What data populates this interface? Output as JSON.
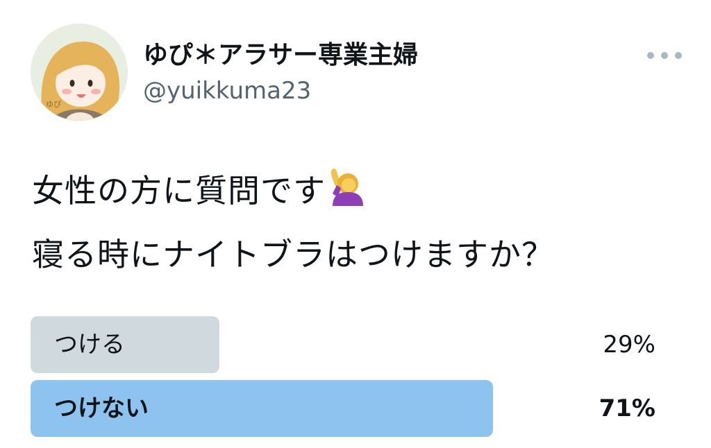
{
  "user": {
    "display_name": "ゆぴ＊アラサー専業主婦",
    "handle": "@yuikkuma23"
  },
  "tweet": {
    "line1": "女性の方に質問です",
    "line2": "寝る時にナイトブラはつけますか？"
  },
  "icons": {
    "more": "more-horizontal-icon",
    "emoji": "woman-raising-hand-emoji"
  },
  "poll": {
    "options": [
      {
        "label": "つける",
        "percent_text": "29%",
        "percent": 29,
        "color": "#cfd9de",
        "winner": false
      },
      {
        "label": "つけない",
        "percent_text": "71%",
        "percent": 71,
        "color": "#8ec3f0",
        "winner": true
      }
    ]
  }
}
